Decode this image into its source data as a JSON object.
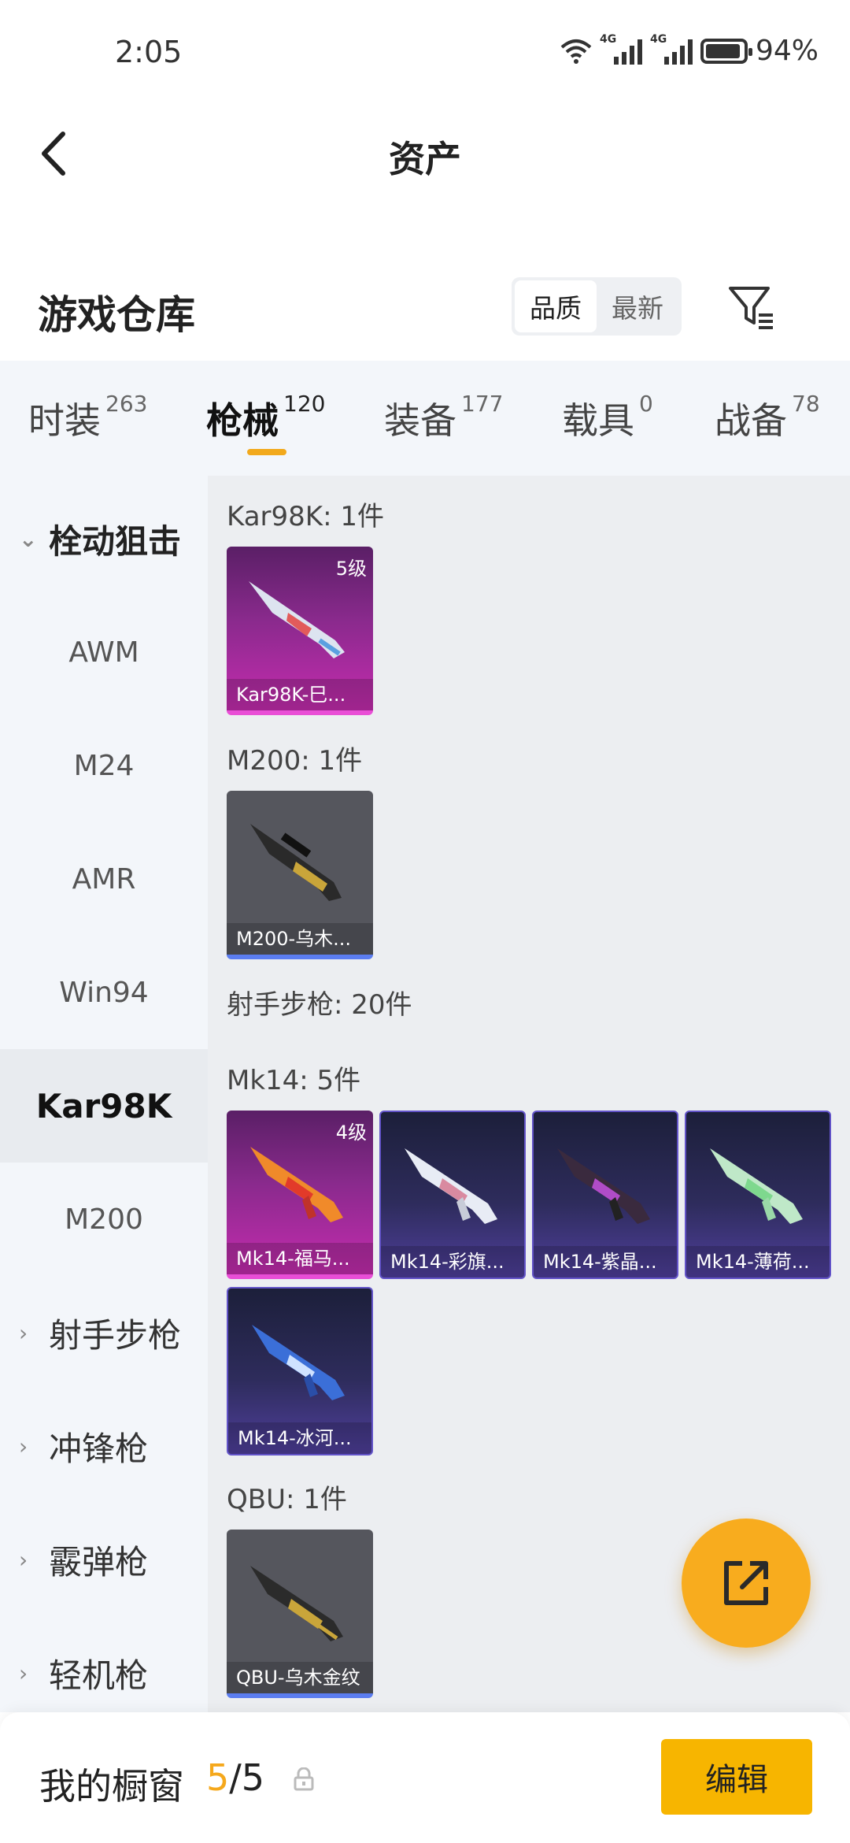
{
  "status": {
    "time": "2:05",
    "network": "4G",
    "battery": "94%"
  },
  "header": {
    "title": "资产"
  },
  "warehouse": {
    "title": "游戏仓库",
    "sort_options": [
      "品质",
      "最新"
    ],
    "active_sort": "品质"
  },
  "tabs": [
    {
      "label": "时装",
      "count": "263"
    },
    {
      "label": "枪械",
      "count": "120"
    },
    {
      "label": "装备",
      "count": "177"
    },
    {
      "label": "载具",
      "count": "0"
    },
    {
      "label": "战备",
      "count": "78"
    }
  ],
  "sidebar": {
    "groups": [
      {
        "label": "栓动狙击"
      },
      {
        "label": "射手步枪"
      },
      {
        "label": "冲锋枪"
      },
      {
        "label": "霰弹枪"
      },
      {
        "label": "轻机枪"
      }
    ],
    "items": [
      "AWM",
      "M24",
      "AMR",
      "Win94",
      "Kar98K",
      "M200"
    ],
    "selected": "Kar98K"
  },
  "content": {
    "kar98k_header": "Kar98K: 1件",
    "kar98k_items": [
      {
        "name": "Kar98K-巳...",
        "level": "5级"
      }
    ],
    "m200_header": "M200: 1件",
    "m200_items": [
      {
        "name": "M200-乌木..."
      }
    ],
    "dmr_header": "射手步枪: 20件",
    "mk14_header": "Mk14: 5件",
    "mk14_items": [
      {
        "name": "Mk14-福马...",
        "level": "4级"
      },
      {
        "name": "Mk14-彩旗..."
      },
      {
        "name": "Mk14-紫晶..."
      },
      {
        "name": "Mk14-薄荷..."
      },
      {
        "name": "Mk14-冰河..."
      }
    ],
    "qbu_header": "QBU: 1件",
    "qbu_items": [
      {
        "name": "QBU-乌木金纹"
      }
    ]
  },
  "bottom": {
    "label": "我的橱窗",
    "current": "5",
    "separator": "/",
    "total": "5",
    "edit_label": "编辑"
  },
  "colors": {
    "accent": "#F7B500",
    "legend": "#C42CAE",
    "epic": "#4F3F9C",
    "rare": "#55565D"
  }
}
